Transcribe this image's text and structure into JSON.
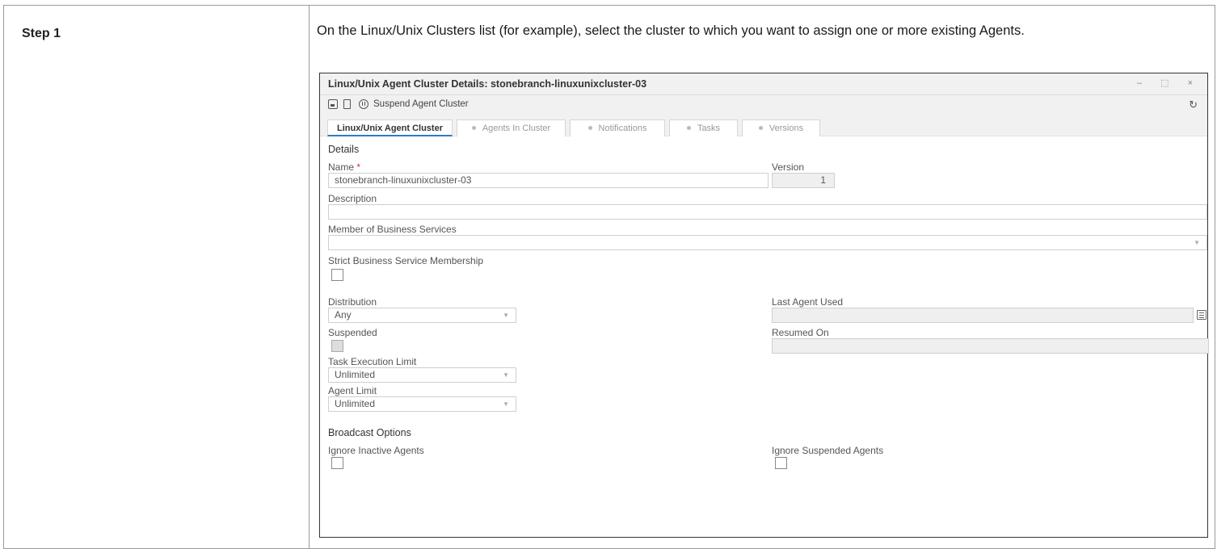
{
  "step": {
    "label": "Step 1"
  },
  "instruction": "On the Linux/Unix Clusters list (for example), select the cluster to which you want to assign one or more existing Agents.",
  "window": {
    "title": "Linux/Unix Agent Cluster Details: stonebranch-linuxunixcluster-03",
    "controls": "– ⬚ ×"
  },
  "toolbar": {
    "suspend_label": "Suspend Agent Cluster",
    "refresh_icon": "↻"
  },
  "tabs": [
    {
      "label": "Linux/Unix Agent Cluster",
      "active": true
    },
    {
      "label": "Agents In Cluster",
      "active": false
    },
    {
      "label": "Notifications",
      "active": false
    },
    {
      "label": "Tasks",
      "active": false
    },
    {
      "label": "Versions",
      "active": false
    }
  ],
  "form": {
    "details_section": "Details",
    "name_label": "Name",
    "required_mark": " *",
    "name_value": "stonebranch-linuxunixcluster-03",
    "version_label": "Version",
    "version_value": "1",
    "description_label": "Description",
    "description_value": "",
    "business_services_label": "Member of Business Services",
    "strict_membership_label": "Strict Business Service Membership",
    "distribution_label": "Distribution",
    "distribution_value": "Any",
    "last_agent_label": "Last Agent Used",
    "last_agent_value": "",
    "suspended_label": "Suspended",
    "resumed_on_label": "Resumed On",
    "resumed_on_value": "",
    "task_exec_limit_label": "Task Execution Limit",
    "task_exec_limit_value": "Unlimited",
    "agent_limit_label": "Agent Limit",
    "agent_limit_value": "Unlimited",
    "broadcast_section": "Broadcast Options",
    "ignore_inactive_label": "Ignore Inactive Agents",
    "ignore_suspended_label": "Ignore Suspended Agents",
    "dropdown_caret": "▼"
  }
}
